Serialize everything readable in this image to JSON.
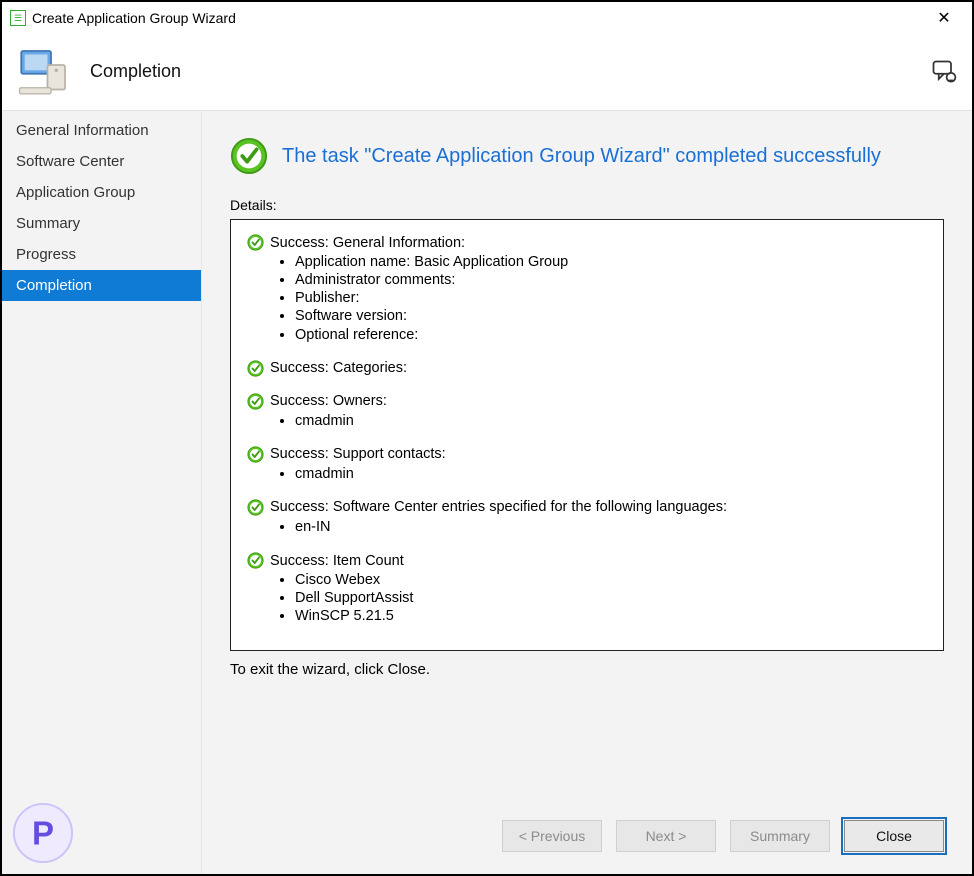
{
  "window": {
    "title": "Create Application Group Wizard",
    "close_glyph": "✕"
  },
  "banner": {
    "page_title": "Completion"
  },
  "sidebar": {
    "steps": [
      "General Information",
      "Software Center",
      "Application Group",
      "Summary",
      "Progress",
      "Completion"
    ],
    "active_index": 5
  },
  "main": {
    "message": "The task \"Create Application Group Wizard\" completed successfully",
    "details_label": "Details:",
    "sections": [
      {
        "title": "Success: General Information:",
        "items": [
          "Application name: Basic Application Group",
          "Administrator comments:",
          "Publisher:",
          "Software version:",
          "Optional reference:"
        ]
      },
      {
        "title": "Success: Categories:",
        "items": []
      },
      {
        "title": "Success: Owners:",
        "items": [
          "cmadmin"
        ]
      },
      {
        "title": "Success: Support contacts:",
        "items": [
          "cmadmin"
        ]
      },
      {
        "title": "Success: Software Center entries specified for the following languages:",
        "items": [
          "en-IN"
        ]
      },
      {
        "title": "Success: Item Count",
        "items": [
          "Cisco Webex",
          "Dell SupportAssist",
          "WinSCP 5.21.5"
        ]
      }
    ],
    "exit_text": "To exit the wizard, click Close."
  },
  "buttons": {
    "previous": "< Previous",
    "next": "Next >",
    "summary": "Summary",
    "close": "Close"
  }
}
